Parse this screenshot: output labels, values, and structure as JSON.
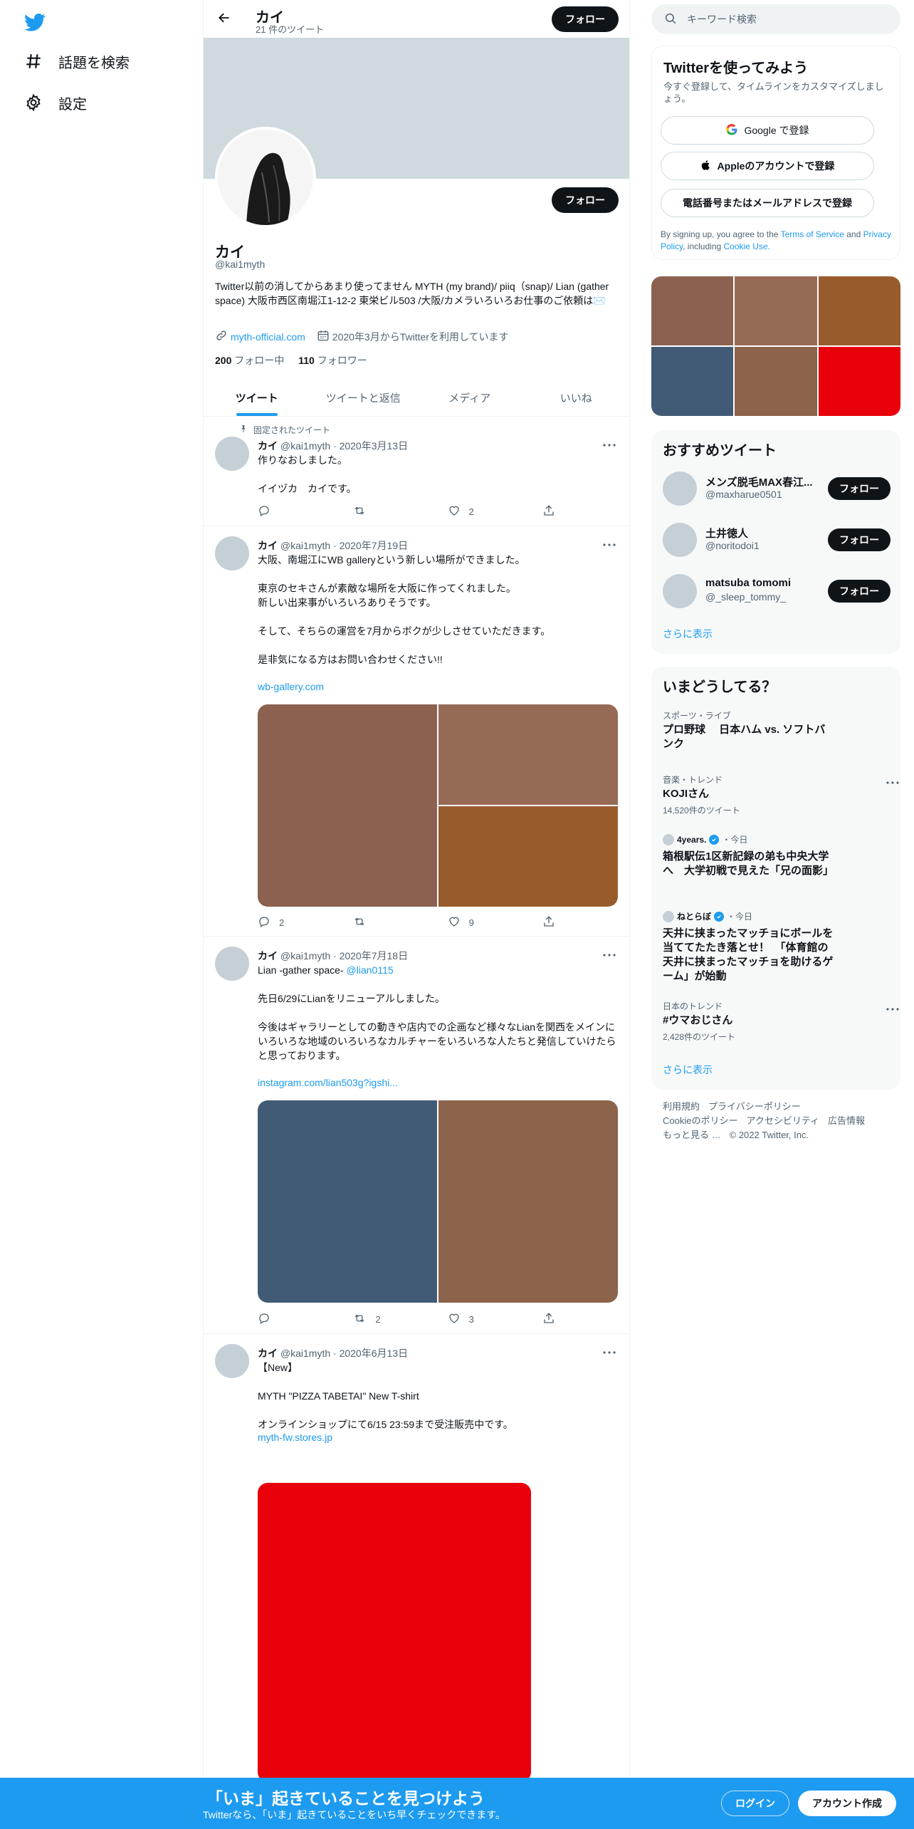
{
  "nav": {
    "explore": "話題を検索",
    "settings": "設定"
  },
  "header": {
    "name": "カイ",
    "tweet_count": "21 件のツイート",
    "follow": "フォロー"
  },
  "profile": {
    "name": "カイ",
    "handle": "@kai1myth",
    "bio": "Twitter以前の消してからあまり使ってません MYTH (my brand)/ piiq（snap)/ Lian (gather space) 大阪市西区南堀江1-12-2 東栄ビル503 /大阪/カメラいろいろお仕事のご依頼は✉️",
    "website": "myth-official.com",
    "joined": "2020年3月からTwitterを利用しています",
    "following_count": "200",
    "following_label": "フォロー中",
    "followers_count": "110",
    "followers_label": "フォロワー",
    "follow": "フォロー"
  },
  "tabs": [
    "ツイート",
    "ツイートと返信",
    "メディア",
    "いいね"
  ],
  "tweets": [
    {
      "pinned": "固定されたツイート",
      "name": "カイ",
      "meta": "@kai1myth · 2020年3月13日",
      "lines": [
        "作りなおしました。",
        "",
        "イイヅカ　カイです。"
      ],
      "replies": "",
      "retweets": "",
      "likes": "2"
    },
    {
      "name": "カイ",
      "meta": "@kai1myth · 2020年7月19日",
      "lines": [
        "大阪、南堀江にWB galleryという新しい場所ができました。",
        "",
        "東京のセキさんが素敵な場所を大阪に作ってくれました。",
        "新しい出来事がいろいろありそうです。",
        "",
        "そして、そちらの運営を7月からボクが少しさせていただきます。",
        "",
        "是非気になる方はお問い合わせください!!"
      ],
      "link": "wb-gallery.com",
      "media_colors": [
        "#8c6150",
        "#976a55",
        "#985c2c"
      ],
      "replies": "2",
      "retweets": "",
      "likes": "9"
    },
    {
      "name": "カイ",
      "meta": "@kai1myth · 2020年7月18日",
      "first_line": "Lian -gather space- ",
      "mention": "@lian0115",
      "lines": [
        "",
        "先日6/29にLianをリニューアルしました。",
        "",
        "今後はギャラリーとしての動きや店内での企画など様々なLianを関西をメインにいろいろな地域のいろいろなカルチャーをいろいろな人たちと発信していけたらと思っております。"
      ],
      "link": "instagram.com/lian503g?igshi...",
      "media_colors": [
        "#415a75",
        "#8c634b"
      ],
      "replies": "",
      "retweets": "2",
      "likes": "3"
    },
    {
      "name": "カイ",
      "meta": "@kai1myth · 2020年6月13日",
      "lines": [
        "【New】",
        "",
        "MYTH \"PIZZA TABETAI\" New T-shirt",
        "",
        "オンラインショップにて6/15 23:59まで受注販売中です。"
      ],
      "link": "myth-fw.stores.jp",
      "media_colors": [
        "#e8010b"
      ]
    }
  ],
  "search": {
    "placeholder": "キーワード検索"
  },
  "signup": {
    "title": "Twitterを使ってみよう",
    "subtitle": "今すぐ登録して、タイムラインをカスタマイズしましょう。",
    "google": "Google で登録",
    "apple": "Appleのアカウントで登録",
    "phone": "電話番号またはメールアドレスで登録",
    "fine_prefix": "By signing up, you agree to the ",
    "terms": "Terms of Service",
    "and": " and ",
    "privacy": "Privacy Policy",
    "including": ", including ",
    "cookie": "Cookie Use."
  },
  "media_grid_colors": [
    "#8c6150",
    "#976a55",
    "#985c2c",
    "#415a75",
    "#8c634b",
    "#e8010b"
  ],
  "recommended": {
    "title": "おすすめツイート",
    "users": [
      {
        "name": "メンズ脱毛MAX春江...",
        "handle": "@maxharue0501",
        "follow": "フォロー"
      },
      {
        "name": "土井徳人",
        "handle": "@noritodoi1",
        "follow": "フォロー"
      },
      {
        "name": "matsuba tomomi",
        "handle": "@_sleep_tommy_",
        "follow": "フォロー"
      }
    ],
    "more": "さらに表示"
  },
  "trends": {
    "title": "いまどうしてる？",
    "items": [
      {
        "category": "スポーツ・ライブ",
        "title": "プロ野球　 日本ハム vs. ソフトバンク"
      },
      {
        "category": "音楽・トレンド",
        "title": "KOJIさん",
        "count": "14,520件のツイート"
      },
      {
        "source": "4years.",
        "time": "・今日",
        "title": "箱根駅伝1区新記録の弟も中央大学へ　大学初戦で見えた「兄の面影」"
      },
      {
        "source": "ねとらぼ",
        "time": "・今日",
        "title": "天井に挟まったマッチョにボールを当ててたたき落とせ！　「体育館の天井に挟まったマッチョを助けるゲーム」が始動"
      },
      {
        "category": "日本のトレンド",
        "title": "#ウマおじさん",
        "count": "2,428件のツイート"
      }
    ],
    "more": "さらに表示"
  },
  "footer": {
    "links": [
      "利用規約",
      "プライバシーポリシー",
      "Cookieのポリシー",
      "アクセシビリティ",
      "広告情報",
      "もっと見る …"
    ],
    "copyright": "© 2022 Twitter, Inc."
  },
  "bottom_bar": {
    "title": "「いま」起きていることを見つけよう",
    "subtitle": "Twitterなら、「いま」起きていることをいち早くチェックできます。",
    "login": "ログイン",
    "signup": "アカウント作成"
  }
}
